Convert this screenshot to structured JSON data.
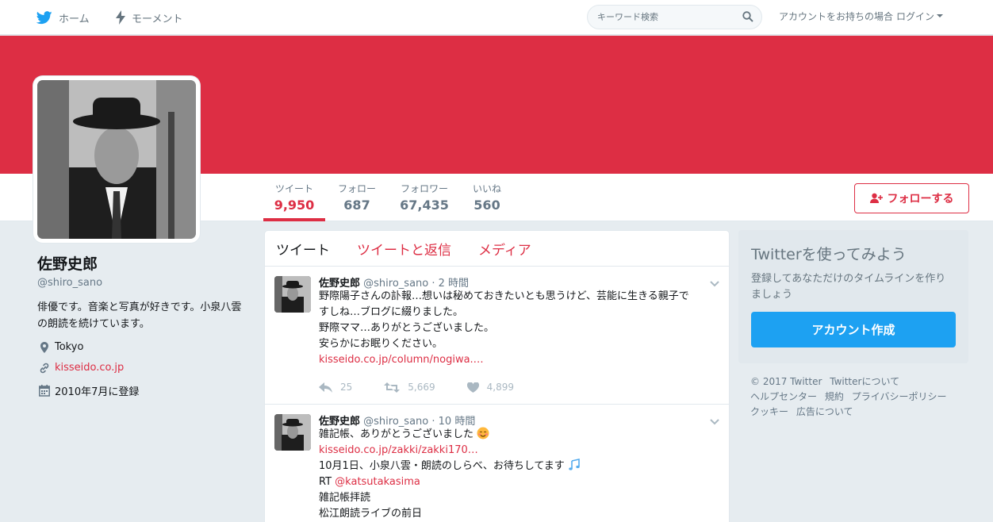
{
  "nav": {
    "home_label": "ホーム",
    "moments_label": "モーメント",
    "search_placeholder": "キーワード検索",
    "login_prompt": "アカウントをお持ちの場合",
    "login_label": "ログイン"
  },
  "colors": {
    "brand": "#dd2e44",
    "twitter_blue": "#1da1f2"
  },
  "stats": [
    {
      "label": "ツイート",
      "value": "9,950"
    },
    {
      "label": "フォロー",
      "value": "687"
    },
    {
      "label": "フォロワー",
      "value": "67,435"
    },
    {
      "label": "いいね",
      "value": "560"
    }
  ],
  "follow_button": "フォローする",
  "profile": {
    "name": "佐野史郎",
    "handle": "@shiro_sano",
    "bio": "俳優です。音楽と写真が好きです。小泉八雲の朗読を続けています。",
    "location": "Tokyo",
    "url": "kisseido.co.jp",
    "joined": "2010年7月に登録"
  },
  "timeline": {
    "tabs": [
      "ツイート",
      "ツイートと返信",
      "メディア"
    ],
    "tweets": [
      {
        "name": "佐野史郎",
        "handle": "@shiro_sano",
        "time": "· 2 時間",
        "lines": [
          "野際陽子さんの訃報…想いは秘めておきたいとも思うけど、芸能に生きる親子で",
          "すしね…ブログに綴りました。",
          "野際ママ…ありがとうございました。",
          "安らかにお眠りください。"
        ],
        "link": "kisseido.co.jp/column/nogiwa.…",
        "replies": "25",
        "retweets": "5,669",
        "likes": "4,899"
      },
      {
        "name": "佐野史郎",
        "handle": "@shiro_sano",
        "time": "· 10 時間",
        "line1": "雑記帳、ありがとうございました",
        "link": "kisseido.co.jp/zakki/zakki170…",
        "line2": "10月1日、小泉八雲・朗読のしらべ、お待ちしてます",
        "rt_prefix": "RT ",
        "rt_handle": "@katsutakasima",
        "line3": "雑記帳拝読",
        "line4": "松江朗読ライブの前日"
      }
    ]
  },
  "signup": {
    "title": "Twitterを使ってみよう",
    "text": "登録してあなただけのタイムラインを作りましょう",
    "button": "アカウント作成"
  },
  "footer": [
    "© 2017 Twitter",
    "Twitterについて",
    "ヘルプセンター",
    "規約",
    "プライバシーポリシー",
    "クッキー",
    "広告について"
  ]
}
